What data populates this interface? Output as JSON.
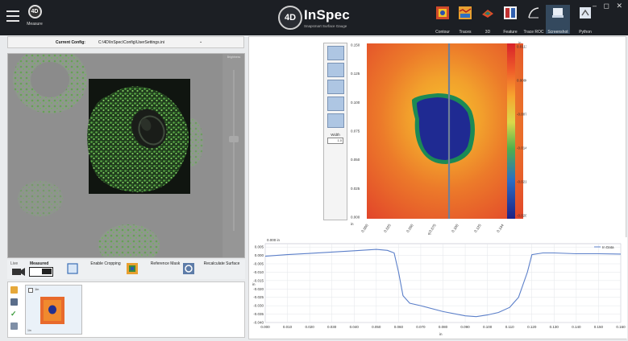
{
  "titlebar": {
    "measure_label": "Measure",
    "logo_text": "4D",
    "brand_name": "InSpec",
    "brand_tagline": "Snapsmart Surface Gauge",
    "window_controls": "– ◻ ✕",
    "tools": [
      {
        "label": "Contour",
        "icon": "contour-icon"
      },
      {
        "label": "Traces",
        "icon": "traces-icon"
      },
      {
        "label": "3D",
        "icon": "3d-icon"
      },
      {
        "label": "Feature",
        "icon": "feature-icon"
      },
      {
        "label": "Trace ROC",
        "icon": "trace-roc-icon"
      },
      {
        "label": "Screenshot",
        "icon": "screenshot-icon"
      },
      {
        "label": "Python",
        "icon": "python-icon"
      }
    ],
    "active_tool": "Screenshot"
  },
  "config": {
    "label": "Current Config:",
    "path": "C:\\4D\\InSpec\\Config\\UserSettings.ini"
  },
  "camera": {
    "slider_label": "Brightness"
  },
  "controls": {
    "live_label": "Live",
    "measured_label": "Measured",
    "cropping_label": "Enable Cropping",
    "reference_label": "Reference Mask",
    "recalc_label": "Recalculate Surface"
  },
  "thumbnails": {
    "item_label": "1in",
    "footer": "1in"
  },
  "map": {
    "width_label": "Width",
    "width_value": "1.0",
    "unit_label": "in",
    "colorbar_ticks": [
      "0.0113",
      "0.0000",
      "-0.0071",
      "-0.0142",
      "-0.0213",
      "-0.0284"
    ],
    "y_ticks": [
      "0.150",
      "0.125",
      "0.100",
      "0.075",
      "0.050",
      "0.025",
      "0.000"
    ],
    "x_ticks": [
      "0.000",
      "0.025",
      "0.050",
      "0.075",
      "0.100",
      "0.125",
      "0.144"
    ],
    "x_unit": "in",
    "y_unit": "in"
  },
  "profile": {
    "top_label": "0.000 in",
    "legend": "In Data",
    "x_unit": "in",
    "y_unit": "in"
  },
  "chart_data": {
    "type": "line",
    "series": [
      {
        "name": "In Data",
        "x": [
          0.0,
          0.01,
          0.02,
          0.03,
          0.04,
          0.05,
          0.055,
          0.058,
          0.06,
          0.062,
          0.065,
          0.07,
          0.08,
          0.09,
          0.095,
          0.1,
          0.105,
          0.11,
          0.114,
          0.118,
          0.12,
          0.125,
          0.13,
          0.14,
          0.15,
          0.16
        ],
        "y": [
          -0.0005,
          0.0005,
          0.0012,
          0.002,
          0.0028,
          0.0036,
          0.003,
          0.0015,
          -0.01,
          -0.024,
          -0.0285,
          -0.03,
          -0.0335,
          -0.036,
          -0.0365,
          -0.0355,
          -0.034,
          -0.031,
          -0.025,
          -0.01,
          0.0005,
          0.0015,
          0.0015,
          0.001,
          0.001,
          0.0008
        ]
      }
    ],
    "x_ticks": [
      "0.000",
      "0.010",
      "0.020",
      "0.030",
      "0.040",
      "0.050",
      "0.060",
      "0.070",
      "0.080",
      "0.090",
      "0.100",
      "0.110",
      "0.120",
      "0.130",
      "0.140",
      "0.150",
      "0.160"
    ],
    "y_ticks": [
      "0.005",
      "0.000",
      "-0.005",
      "-0.010",
      "-0.015",
      "-0.020",
      "-0.025",
      "-0.030",
      "-0.035",
      "-0.040"
    ],
    "xlim": [
      0.0,
      0.16
    ],
    "ylim": [
      -0.04,
      0.007
    ],
    "xlabel": "in",
    "ylabel": "in",
    "grid": true,
    "legend_position": "top-right",
    "series_color": "#5b7fc9"
  }
}
